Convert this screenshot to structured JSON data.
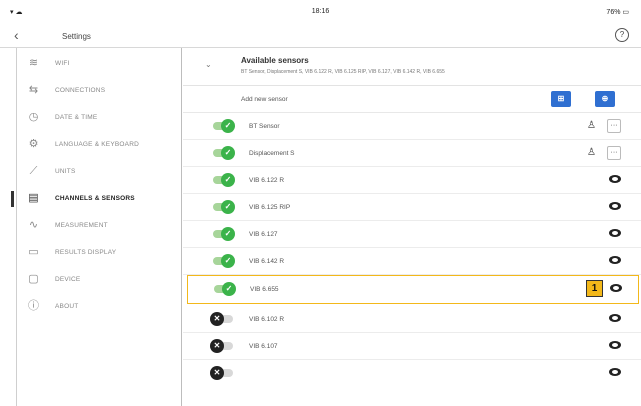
{
  "status": {
    "time": "18:16",
    "battery": "76%"
  },
  "header": {
    "title": "Settings"
  },
  "sidebar": {
    "items": [
      {
        "label": "WIFI",
        "icon": "wifi-icon"
      },
      {
        "label": "CONNECTIONS",
        "icon": "connections-icon"
      },
      {
        "label": "DATE & TIME",
        "icon": "clock-icon"
      },
      {
        "label": "LANGUAGE & KEYBOARD",
        "icon": "language-icon"
      },
      {
        "label": "UNITS",
        "icon": "ruler-icon"
      },
      {
        "label": "CHANNELS & SENSORS",
        "icon": "sensor-icon",
        "active": true
      },
      {
        "label": "MEASUREMENT",
        "icon": "measurement-icon"
      },
      {
        "label": "RESULTS DISPLAY",
        "icon": "results-display-icon"
      },
      {
        "label": "DEVICE",
        "icon": "device-icon"
      },
      {
        "label": "ABOUT",
        "icon": "info-icon"
      }
    ]
  },
  "panel": {
    "title": "Available sensors",
    "subtitle": "BT Sensor, Displacement S, VIB 6.122 R, VIB 6.125 RIP, VIB 6.127, VIB 6.142 R, VIB 6.655",
    "add_label": "Add new sensor"
  },
  "sensors": [
    {
      "name": "BT Sensor",
      "enabled": true,
      "type": "user"
    },
    {
      "name": "Displacement S",
      "enabled": true,
      "type": "user"
    },
    {
      "name": "VIB 6.122 R",
      "enabled": true,
      "type": "view"
    },
    {
      "name": "VIB 6.125 RIP",
      "enabled": true,
      "type": "view"
    },
    {
      "name": "VIB 6.127",
      "enabled": true,
      "type": "view"
    },
    {
      "name": "VIB 6.142 R",
      "enabled": true,
      "type": "view"
    },
    {
      "name": "VIB 6.655",
      "enabled": true,
      "type": "view",
      "highlight": true,
      "badge": "1"
    },
    {
      "name": "VIB 6.102 R",
      "enabled": false,
      "type": "view"
    },
    {
      "name": "VIB 6.107",
      "enabled": false,
      "type": "view"
    }
  ],
  "colors": {
    "accent_blue": "#2f6fd1",
    "enabled_green": "#3bb34a",
    "highlight": "#f3b81a"
  }
}
